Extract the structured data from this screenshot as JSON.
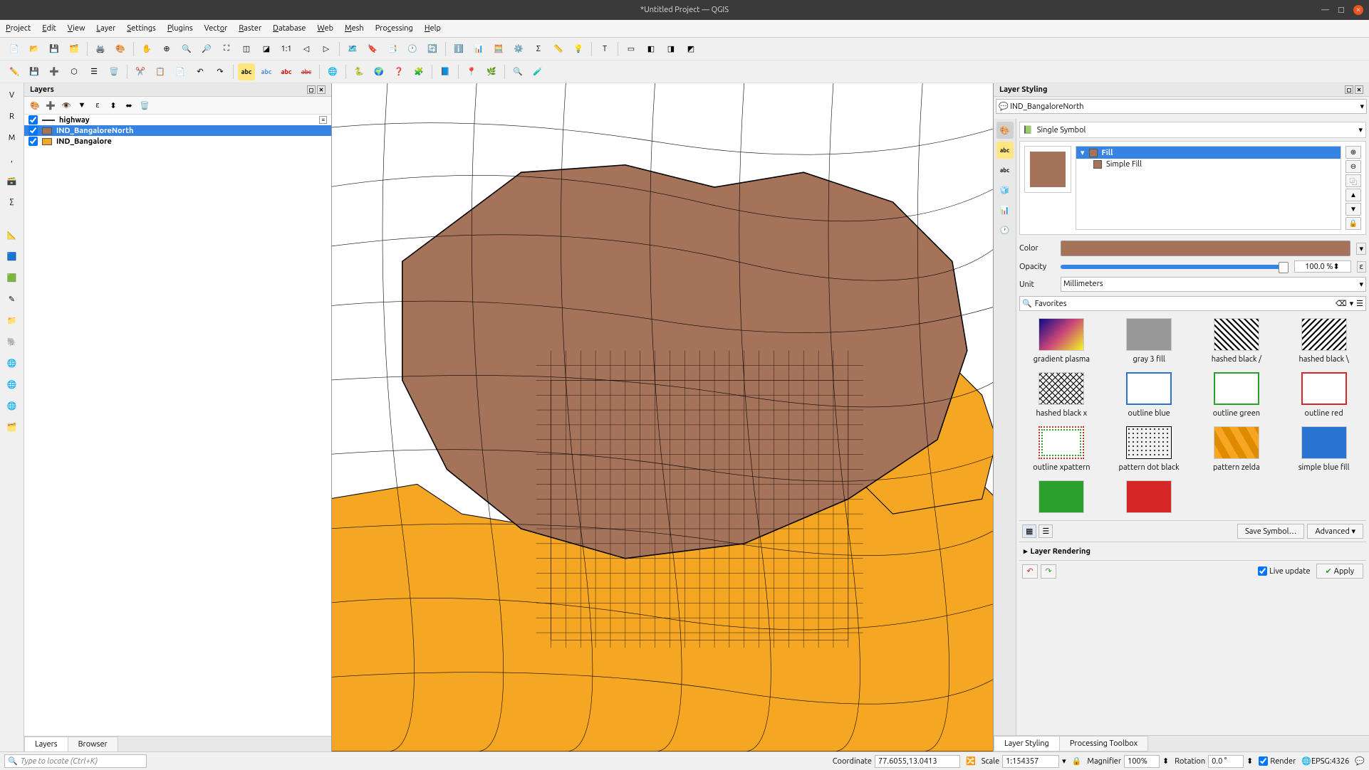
{
  "window": {
    "title": "*Untitled Project — QGIS"
  },
  "menu": [
    "Project",
    "Edit",
    "View",
    "Layer",
    "Settings",
    "Plugins",
    "Vector",
    "Raster",
    "Database",
    "Web",
    "Mesh",
    "Processing",
    "Help"
  ],
  "panels": {
    "layers": {
      "title": "Layers",
      "items": [
        {
          "name": "highway",
          "checked": true,
          "type": "line",
          "color": "#333",
          "selected": false
        },
        {
          "name": "IND_BangaloreNorth",
          "checked": true,
          "type": "fill",
          "color": "#a5725a",
          "selected": true
        },
        {
          "name": "IND_Bangalore",
          "checked": true,
          "type": "fill",
          "color": "#f5a623",
          "selected": false
        }
      ],
      "tabs": [
        "Layers",
        "Browser"
      ]
    },
    "styling": {
      "title": "Layer Styling",
      "selected_layer": "IND_BangaloreNorth",
      "symbol_type": "Single Symbol",
      "tree": {
        "fill": "Fill",
        "simple_fill": "Simple Fill"
      },
      "color": "#a5725a",
      "opacity": "100.0 %",
      "unit": "Millimeters",
      "favorites_label": "Favorites",
      "styles": [
        "gradient plasma",
        "gray 3 fill",
        "hashed black /",
        "hashed black \\",
        "hashed black x",
        "outline blue",
        "outline green",
        "outline red",
        "outline xpattern",
        "pattern dot black",
        "pattern zelda",
        "simple blue fill"
      ],
      "save_symbol": "Save Symbol…",
      "advanced": "Advanced",
      "layer_rendering": "Layer Rendering",
      "live_update": "Live update",
      "apply": "Apply",
      "tabs": [
        "Layer Styling",
        "Processing Toolbox"
      ]
    }
  },
  "statusbar": {
    "locator_placeholder": "Type to locate (Ctrl+K)",
    "coordinate_label": "Coordinate",
    "coordinate": "77.6055,13.0413",
    "scale_label": "Scale",
    "scale": "1:154357",
    "magnifier_label": "Magnifier",
    "magnifier": "100%",
    "rotation_label": "Rotation",
    "rotation": "0.0 °",
    "render": "Render",
    "crs": "EPSG:4326"
  },
  "colors": {
    "brown": "#a5725a",
    "orange": "#f5a623",
    "selection": "#3584e4"
  }
}
